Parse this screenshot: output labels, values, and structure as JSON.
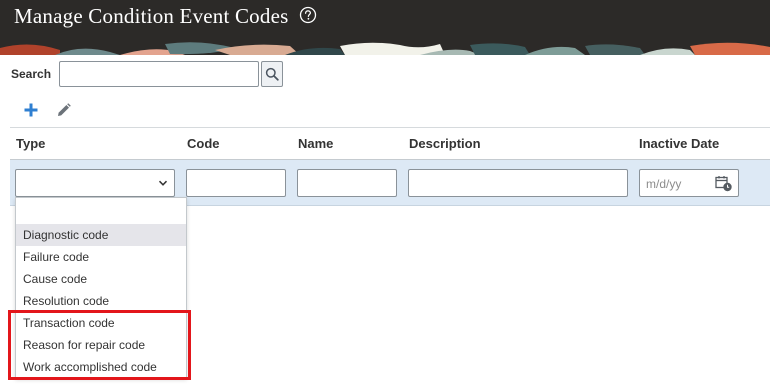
{
  "header": {
    "title": "Manage Condition Event Codes",
    "help_icon": "help-circle-icon",
    "background_color": "#2c2a28"
  },
  "search": {
    "label": "Search",
    "value": "",
    "button_icon": "magnifier-icon"
  },
  "toolbar": {
    "add_icon": "plus-icon",
    "edit_icon": "pencil-icon",
    "add_color": "#2f7fd1"
  },
  "table": {
    "columns": [
      "Type",
      "Code",
      "Name",
      "Description",
      "Inactive Date"
    ],
    "row": {
      "type_value": "",
      "code_value": "",
      "name_value": "",
      "description_value": "",
      "date_placeholder": "m/d/yy",
      "date_icon": "calendar-clock-icon"
    },
    "row_color": "#dde9f5"
  },
  "type_dropdown": {
    "options": [
      "",
      "Diagnostic code",
      "Failure code",
      "Cause code",
      "Resolution code",
      "Transaction code",
      "Reason for repair code",
      "Work accomplished code"
    ],
    "hovered_option": "Diagnostic code",
    "highlighted_options": [
      "Transaction code",
      "Reason for repair code",
      "Work accomplished code"
    ],
    "highlight_color": "#e3161b"
  }
}
